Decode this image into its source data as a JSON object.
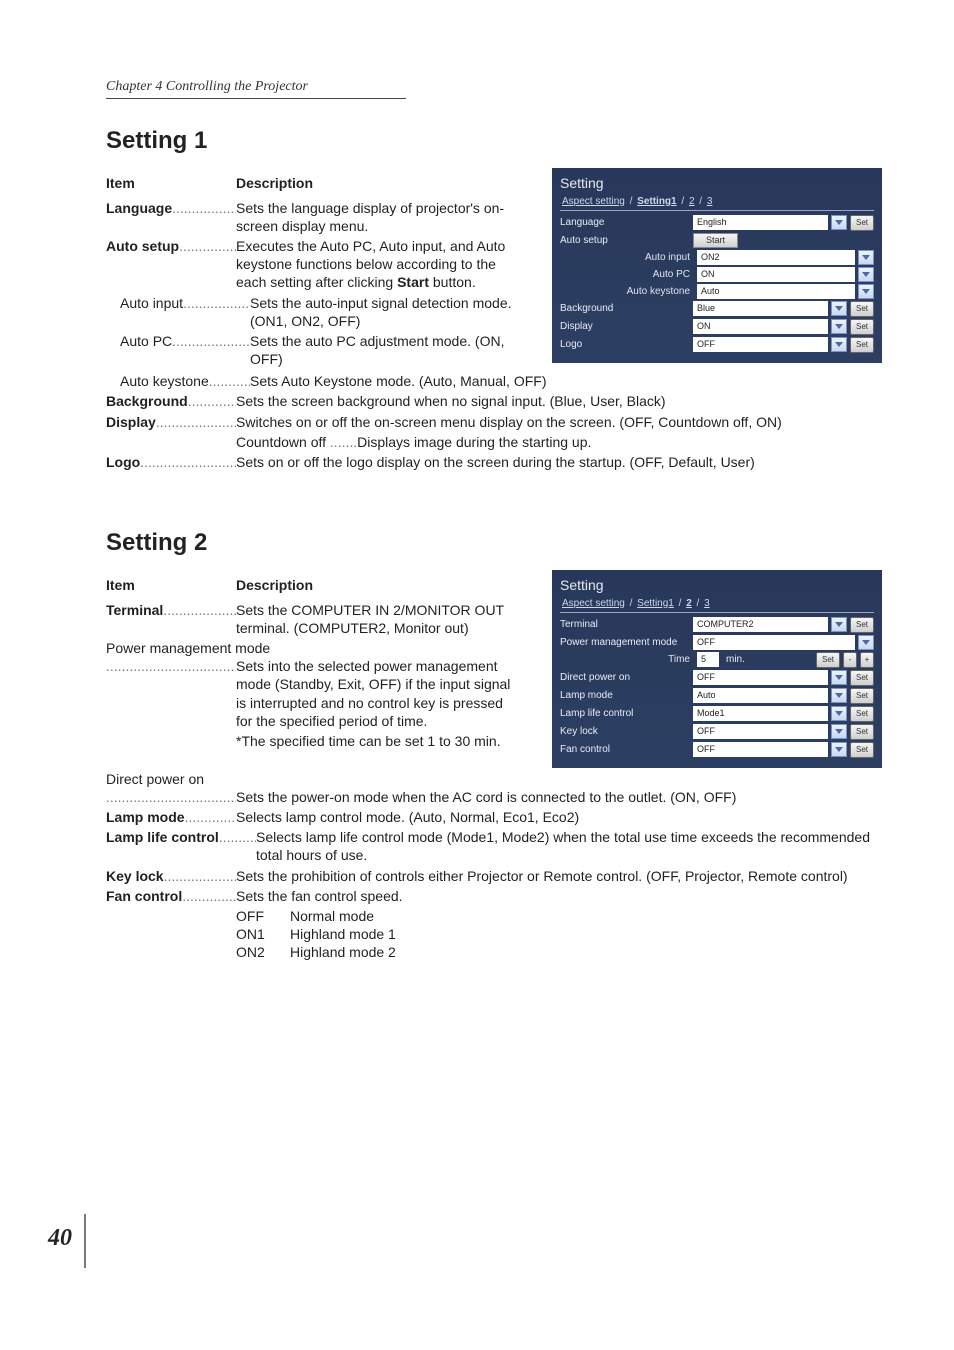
{
  "header": {
    "chapter": "Chapter 4 Controlling the Projector"
  },
  "page_number": "40",
  "common": {
    "item_label": "Item",
    "desc_label": "Description",
    "dots": ".............................................................................................."
  },
  "s1": {
    "title": "Setting 1",
    "rows": {
      "language": {
        "term": "Language",
        "desc": "Sets the language display of projector's on-screen display menu."
      },
      "autosetup": {
        "term": "Auto setup",
        "desc_a": "Executes the Auto PC, Auto input, and Auto keystone functions below according to the each setting after clicking ",
        "start_bold": "Start",
        "desc_b": " button."
      },
      "autoinput": {
        "term": "Auto input",
        "desc": "Sets the auto-input signal detection mode. (ON1, ON2, OFF)"
      },
      "autopc": {
        "term": "Auto PC",
        "desc": "Sets the auto PC adjustment mode. (ON, OFF)"
      },
      "autokey": {
        "term": "Auto keystone",
        "desc": "Sets Auto Keystone mode. (Auto, Manual, OFF)"
      },
      "background": {
        "term": "Background",
        "desc": "Sets the screen background  when no signal input. (Blue, User, Black)"
      },
      "display": {
        "term": "Display",
        "desc": "Switches on or off the on-screen menu display on the screen. (OFF, Countdown off, ON)"
      },
      "display_sub": {
        "term": "Countdown off",
        "desc": "Displays image during the starting up."
      },
      "logo": {
        "term": "Logo",
        "desc": "Sets on or off the logo display on the screen during the startup. (OFF, Default, User)"
      }
    },
    "panel": {
      "title": "Setting",
      "tabs": {
        "a": "Aspect setting",
        "b": "Setting1",
        "c": "2",
        "d": "3"
      },
      "language": {
        "label": "Language",
        "value": "English",
        "set": "Set"
      },
      "autosetup": {
        "label": "Auto setup",
        "start": "Start"
      },
      "autoinput": {
        "label": "Auto input",
        "value": "ON2"
      },
      "autopc": {
        "label": "Auto PC",
        "value": "ON"
      },
      "autokey": {
        "label": "Auto keystone",
        "value": "Auto"
      },
      "background": {
        "label": "Background",
        "value": "Blue",
        "set": "Set"
      },
      "display": {
        "label": "Display",
        "value": "ON",
        "set": "Set"
      },
      "logo": {
        "label": "Logo",
        "value": "OFF",
        "set": "Set"
      }
    }
  },
  "s2": {
    "title": "Setting 2",
    "rows": {
      "terminal": {
        "term": "Terminal",
        "desc": "Sets the COMPUTER IN 2/MONITOR OUT terminal. (COMPUTER2, Monitor out)"
      },
      "pmm_head": "Power management mode",
      "pmm": {
        "desc": "Sets into the selected power management mode (Standby, Exit, OFF) if the input signal is interrupted and no control key is pressed for the specified period of time."
      },
      "pmm_note": "*The specified time can be set 1 to 30 min.",
      "dpo_head": "Direct power on",
      "dpo": {
        "desc": "Sets the power-on mode when the AC cord is connected to the outlet. (ON, OFF)"
      },
      "lampmode": {
        "term": "Lamp mode",
        "desc": "Selects lamp control mode. (Auto, Normal, Eco1, Eco2)"
      },
      "lamplife": {
        "term": "Lamp life control",
        "desc": "Selects lamp life control mode (Mode1, Mode2) when the total use time exceeds the recommended total hours of use."
      },
      "keylock": {
        "term": "Key lock",
        "desc": "Sets the prohibition of controls either Projector or Remote control. (OFF, Projector, Remote control)"
      },
      "fan": {
        "term": "Fan control",
        "desc": "Sets the fan control speed."
      },
      "fan_off": {
        "k": "OFF",
        "v": "Normal mode"
      },
      "fan_on1": {
        "k": "ON1",
        "v": "Highland mode 1"
      },
      "fan_on2": {
        "k": "ON2",
        "v": "Highland mode 2"
      }
    },
    "panel": {
      "title": "Setting",
      "tabs": {
        "a": "Aspect setting",
        "b": "Setting1",
        "c": "2",
        "d": "3"
      },
      "terminal": {
        "label": "Terminal",
        "value": "COMPUTER2",
        "set": "Set"
      },
      "pmm": {
        "label": "Power management mode",
        "value": "OFF"
      },
      "pmm_time": {
        "label": "Time",
        "value": "5",
        "unit": "min.",
        "set": "Set",
        "minus": "-",
        "plus": "+"
      },
      "dpo": {
        "label": "Direct power on",
        "value": "OFF",
        "set": "Set"
      },
      "lampmode": {
        "label": "Lamp mode",
        "value": "Auto",
        "set": "Set"
      },
      "lamplife": {
        "label": "Lamp life control",
        "value": "Mode1",
        "set": "Set"
      },
      "keylock": {
        "label": "Key lock",
        "value": "OFF",
        "set": "Set"
      },
      "fan": {
        "label": "Fan control",
        "value": "OFF",
        "set": "Set"
      }
    }
  }
}
